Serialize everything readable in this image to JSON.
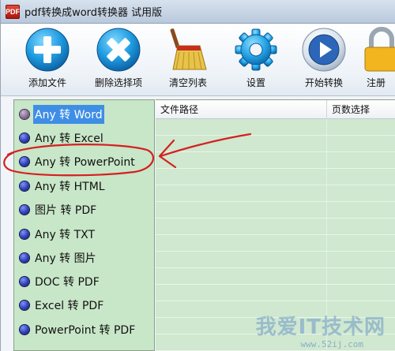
{
  "window": {
    "title": "pdf转换成word转换器 试用版",
    "icon_text": "PDF"
  },
  "toolbar": {
    "add_file": "添加文件",
    "delete_selected": "删除选择项",
    "clear_list": "清空列表",
    "settings": "设置",
    "start_convert": "开始转换",
    "register": "注册"
  },
  "formats": [
    {
      "label": "Any 转 Word",
      "selected": true
    },
    {
      "label": "Any 转 Excel",
      "selected": false
    },
    {
      "label": "Any 转 PowerPoint",
      "selected": false
    },
    {
      "label": "Any 转 HTML",
      "selected": false
    },
    {
      "label": "图片 转 PDF",
      "selected": false
    },
    {
      "label": "Any 转 TXT",
      "selected": false
    },
    {
      "label": "Any 转 图片",
      "selected": false
    },
    {
      "label": "DOC 转 PDF",
      "selected": false
    },
    {
      "label": "Excel 转 PDF",
      "selected": false
    },
    {
      "label": "PowerPoint 转 PDF",
      "selected": false
    }
  ],
  "table": {
    "col_path": "文件路径",
    "col_pages": "页数选择"
  },
  "watermark": {
    "text": "我爱IT技术网",
    "url": "www.52ij.com"
  },
  "colors": {
    "list_bg": "#c8e6c8",
    "selection": "#3f8ee6",
    "annotation": "#d42020"
  }
}
